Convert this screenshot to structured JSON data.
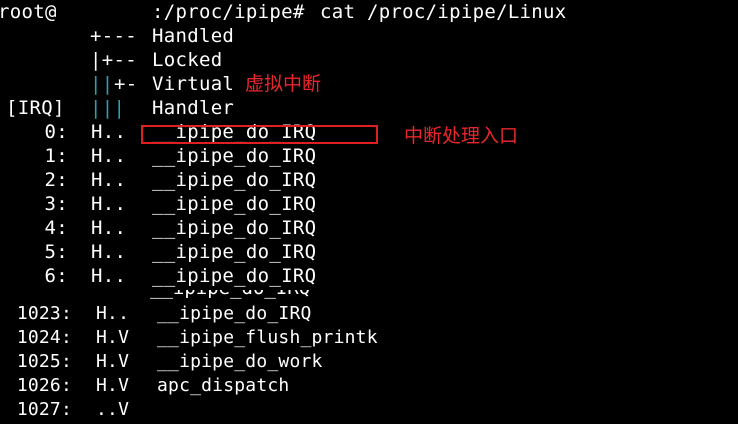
{
  "terminal": {
    "prompt_user": "root@",
    "prompt_path": ":/proc/ipipe#",
    "command": "cat /proc/ipipe/Linux"
  },
  "legend": {
    "line1_prefix": "+---",
    "line1_label": "Handled",
    "line2_prefix": "|+--",
    "line2_label": "Locked",
    "line3_bars": "||",
    "line3_prefix": "+-",
    "line3_label": "Virtual",
    "header_irq": "[IRQ]",
    "line4_bars": "|||",
    "line4_label": "Handler"
  },
  "rows_top": [
    {
      "irq": "0:",
      "flags": "H..",
      "handler": "__ipipe_do_IRQ"
    },
    {
      "irq": "1:",
      "flags": "H..",
      "handler": "__ipipe_do_IRQ"
    },
    {
      "irq": "2:",
      "flags": "H..",
      "handler": "__ipipe_do_IRQ"
    },
    {
      "irq": "3:",
      "flags": "H..",
      "handler": "__ipipe_do_IRQ"
    },
    {
      "irq": "4:",
      "flags": "H..",
      "handler": "__ipipe_do_IRQ"
    },
    {
      "irq": "5:",
      "flags": "H..",
      "handler": "__ipipe_do_IRQ"
    },
    {
      "irq": "6:",
      "flags": "H..",
      "handler": "__ipipe_do_IRQ"
    }
  ],
  "rows_bottom": [
    {
      "irq": "1023:",
      "flags": "H..",
      "handler": "__ipipe_do_IRQ"
    },
    {
      "irq": "1024:",
      "flags": "H.V",
      "handler": "__ipipe_flush_printk"
    },
    {
      "irq": "1025:",
      "flags": "H.V",
      "handler": "__ipipe_do_work"
    },
    {
      "irq": "1026:",
      "flags": "H.V",
      "handler": "apc_dispatch"
    },
    {
      "irq": "1027:",
      "flags": "..V",
      "handler": ""
    }
  ],
  "annotations": {
    "virtual_note": "虚拟中断",
    "handler_note": "中断处理入口",
    "color": "#e8262b"
  }
}
